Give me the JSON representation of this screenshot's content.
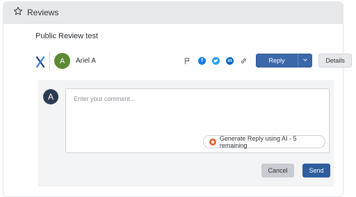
{
  "header": {
    "title": "Reviews",
    "icon": "star-icon"
  },
  "review": {
    "title": "Public Review test",
    "author": {
      "name": "Ariel A",
      "initial": "A",
      "avatar_color": "#5d8a35"
    },
    "source_icon": "brand-x-icon",
    "actions": {
      "icons": [
        "flag-icon",
        "facebook-icon",
        "twitter-icon",
        "linkedin-icon",
        "link-icon"
      ],
      "reply_label": "Reply",
      "details_label": "Details"
    }
  },
  "reply_form": {
    "user_initial": "A",
    "placeholder": "Enter your comment...",
    "ai_button_label": "Generate Reply using AI - 5 remaining",
    "cancel_label": "Cancel",
    "send_label": "Send"
  },
  "colors": {
    "primary": "#3b68a9",
    "facebook": "#1877f2",
    "twitter": "#1da1f2",
    "linkedin": "#0a66c2",
    "ai_accent": "#e3622b"
  }
}
